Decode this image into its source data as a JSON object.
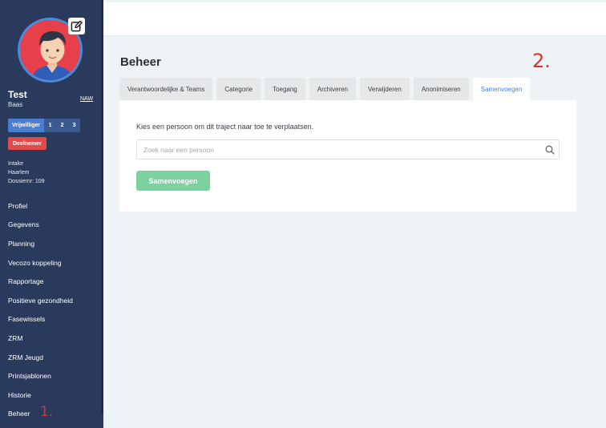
{
  "user": {
    "name": "Test",
    "role": "Baas",
    "naw_link": "NAW",
    "status_label": "Vrijwilliger",
    "status_steps": [
      "1",
      "2",
      "3"
    ],
    "badge": "Deelnemer",
    "meta": [
      "Intake",
      "Haarlem",
      "Dossiernr: 109"
    ]
  },
  "nav": {
    "items": [
      "Profiel",
      "Gegevens",
      "Planning",
      "Vecozo koppeling",
      "Rapportage",
      "Positieve gezondheid",
      "Fasewissels",
      "ZRM",
      "ZRM Jeugd",
      "Printsjablonen",
      "Historie",
      "Beheer"
    ]
  },
  "annotations": {
    "one": "1.",
    "two": "2."
  },
  "page": {
    "title": "Beheer",
    "tabs": [
      "Verantwoordelijke & Teams",
      "Categorie",
      "Toegang",
      "Archiveren",
      "Verwijderen",
      "Anonimiseren",
      "Samenvoegen"
    ],
    "active_tab": "Samenvoegen"
  },
  "panel": {
    "instruction": "Kies een persoon om dit traject naar toe te verplaatsen.",
    "search_placeholder": "Zoek naar een persoon",
    "search_value": "",
    "button_label": "Samenvoegen"
  },
  "colors": {
    "sidebar": "#2a3a5c",
    "accent": "#3f86d9",
    "badge": "#e24a4a",
    "button": "#7dd0a0",
    "annotation": "#e03030"
  },
  "icons": [
    "edit-icon",
    "search-icon",
    "avatar"
  ]
}
